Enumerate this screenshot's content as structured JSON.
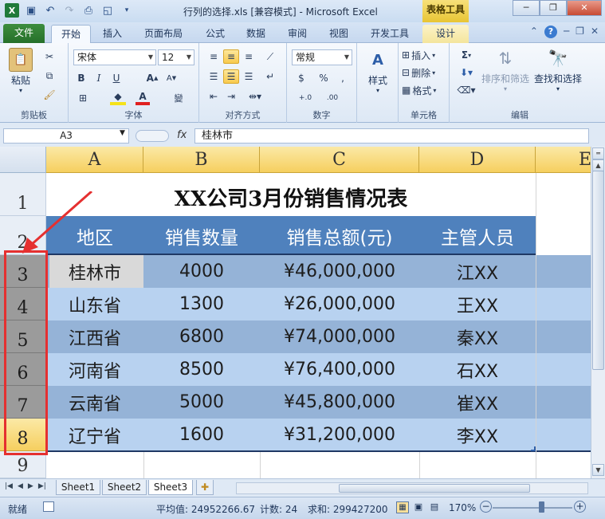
{
  "window": {
    "title": "行列的选择.xls  [兼容模式] - Microsoft Excel",
    "context_tab_group": "表格工具",
    "minimize": "─",
    "restore": "❐",
    "close": "✕"
  },
  "ribbon_tabs": [
    "文件",
    "开始",
    "插入",
    "页面布局",
    "公式",
    "数据",
    "审阅",
    "视图",
    "开发工具",
    "设计"
  ],
  "ribbon": {
    "clipboard": {
      "paste": "粘贴",
      "label": "剪贴板"
    },
    "font": {
      "name": "宋体",
      "size": "12",
      "label": "字体",
      "bold": "B",
      "italic": "I",
      "underline": "U"
    },
    "alignment": {
      "label": "对齐方式"
    },
    "number": {
      "format": "常规",
      "label": "数字",
      "currency": "$",
      "percent": "%",
      "comma": ",",
      "inc": "+.0",
      "dec": ".00"
    },
    "styles": {
      "label": "样式"
    },
    "cells": {
      "insert": "插入",
      "delete": "删除",
      "format": "格式",
      "label": "单元格"
    },
    "editing": {
      "sort_filter": "排序和筛选",
      "find_select": "查找和选择",
      "label": "编辑",
      "sum": "Σ"
    }
  },
  "formula_bar": {
    "name_box": "A3",
    "fx": "fx",
    "content": "桂林市"
  },
  "columns": [
    "A",
    "B",
    "C",
    "D",
    "E"
  ],
  "rows": [
    "1",
    "2",
    "3",
    "4",
    "5",
    "6",
    "7",
    "8",
    "9"
  ],
  "table": {
    "title": "XX公司3月份销售情况表",
    "headers": [
      "地区",
      "销售数量",
      "销售总额(元)",
      "主管人员"
    ],
    "data": [
      [
        "桂林市",
        "4000",
        "¥46,000,000",
        "江XX"
      ],
      [
        "山东省",
        "1300",
        "¥26,000,000",
        "王XX"
      ],
      [
        "江西省",
        "6800",
        "¥74,000,000",
        "秦XX"
      ],
      [
        "河南省",
        "8500",
        "¥76,400,000",
        "石XX"
      ],
      [
        "云南省",
        "5000",
        "¥45,800,000",
        "崔XX"
      ],
      [
        "辽宁省",
        "1600",
        "¥31,200,000",
        "李XX"
      ]
    ]
  },
  "sheet_tabs": [
    "Sheet1",
    "Sheet2",
    "Sheet3"
  ],
  "status_bar": {
    "mode": "就绪",
    "average": "平均值: 24952266.67",
    "count": "计数: 24",
    "sum": "求和: 299427200",
    "zoom": "170%"
  },
  "colors": {
    "header_fill": "#4f81bd",
    "band_dark": "#95b3d7",
    "band_light": "#b8d2f0",
    "selected_row_hdr": "#9b9b9b",
    "active_hdr": "#f6cf5f",
    "annotation": "#e53030"
  }
}
